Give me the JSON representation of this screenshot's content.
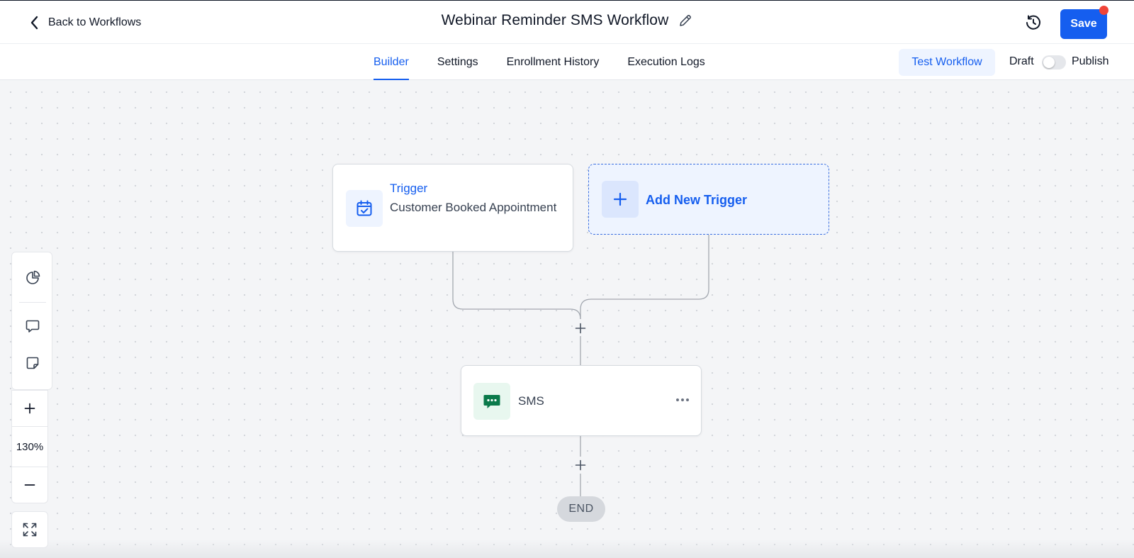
{
  "header": {
    "back_label": "Back to Workflows",
    "title": "Webinar Reminder SMS Workflow",
    "save_label": "Save"
  },
  "tabs": [
    {
      "label": "Builder",
      "active": true
    },
    {
      "label": "Settings",
      "active": false
    },
    {
      "label": "Enrollment History",
      "active": false
    },
    {
      "label": "Execution Logs",
      "active": false
    }
  ],
  "actions": {
    "test_label": "Test Workflow",
    "draft_label": "Draft",
    "publish_label": "Publish",
    "published": false
  },
  "canvas": {
    "trigger": {
      "label": "Trigger",
      "value": "Customer Booked Appointment"
    },
    "add_trigger_label": "Add New Trigger",
    "action_node": {
      "label": "SMS"
    },
    "end_label": "END"
  },
  "zoom": {
    "level": "130%"
  },
  "icons": {
    "back": "chevron-left-icon",
    "edit": "pencil-icon",
    "history": "history-icon",
    "trigger": "calendar-check-icon",
    "add": "plus-icon",
    "sms": "message-dots-icon",
    "more": "more-horizontal-icon",
    "analytics": "pie-chart-icon",
    "comment": "comment-icon",
    "note": "sticky-note-icon",
    "fit": "expand-icon"
  },
  "colors": {
    "primary": "#155eef",
    "primary_light": "#eef4ff",
    "notification": "#f04438",
    "sms_green": "#0b7a4b",
    "end_pill": "#d5d8dd"
  }
}
